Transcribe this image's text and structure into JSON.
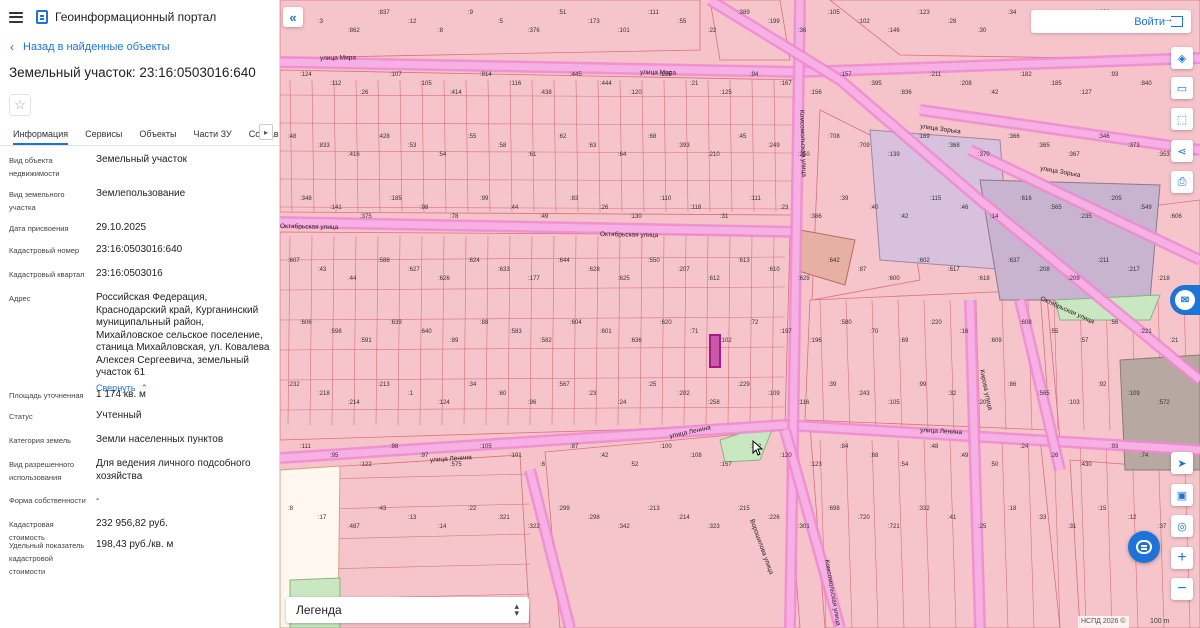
{
  "app": {
    "title": "Геоинформационный портал"
  },
  "panel": {
    "back_label": "Назад в найденные объекты",
    "object_title": "Земельный участок: 23:16:0503016:640",
    "tabs": [
      "Информация",
      "Сервисы",
      "Объекты",
      "Части ЗУ",
      "Состав"
    ],
    "active_tab": "Информация",
    "properties": [
      {
        "label": "Вид объекта недвижимости",
        "value": "Земельный участок"
      },
      {
        "label": "Вид земельного участка",
        "value": "Землепользование"
      },
      {
        "label": "Дата присвоения",
        "value": "29.10.2025"
      },
      {
        "label": "Кадастровый номер",
        "value": "23:16:0503016:640"
      },
      {
        "label": "Кадастровый квартал",
        "value": "23:16:0503016"
      },
      {
        "label": "Адрес",
        "value": "Российская Федерация, Краснодарский край, Курганинский муниципальный район, Михайловское сельское поселение, станица Михайловская, ул. Ковалева Алексея Сергеевича, земельный участок 61"
      },
      {
        "label": "Площадь уточненная",
        "value": "1 174 кв. м"
      },
      {
        "label": "Статус",
        "value": "Учтенный"
      },
      {
        "label": "Категория земель",
        "value": "Земли населенных пунктов"
      },
      {
        "label": "Вид разрешенного использования",
        "value": "Для ведения личного подсобного хозяйства"
      },
      {
        "label": "Форма собственности",
        "value": "-"
      },
      {
        "label": "Кадастровая стоимость",
        "value": "232 956,82 руб."
      },
      {
        "label": "Удельный показатель кадастровой стоимости",
        "value": "198,43 руб./кв. м"
      }
    ],
    "collapse_label": "Свернуть"
  },
  "map": {
    "login_label": "Войти",
    "legend_label": "Легенда",
    "attribution": "НСПД 2026 ©",
    "scale_label": "100 m",
    "streets": [
      "улица Мира",
      "улица Мира",
      "Октябрьская улица",
      "Октябрьская улица",
      "улица Ленина",
      "улица Ленина",
      "улица Ленина",
      "улица Зорька",
      "улица Зорька",
      "Октябрьская улица",
      "Комсомольская улица",
      "Комсомольская улица",
      "Кирова улица",
      "Ворошилова улица"
    ],
    "tools": [
      "layers-icon",
      "ruler-icon",
      "select-area-icon",
      "share-icon",
      "print-icon",
      "navigate-icon",
      "panel-icon",
      "location-icon",
      "zoom-in-icon",
      "zoom-out-icon"
    ],
    "parcel_labels": [
      ":830",
      ":3",
      ":862",
      ":837",
      ":12",
      ":8",
      ":9",
      ":5",
      ":376",
      ":51",
      ":173",
      ":101",
      ":111",
      ":55",
      ":22",
      ":389",
      ":199",
      ":36",
      ":105",
      ":102",
      ":146",
      ":123",
      ":28",
      ":30",
      ":34",
      ":160",
      ":66",
      ":128",
      ":106",
      ":110",
      ":124",
      ":112",
      ":26",
      ":107",
      ":105",
      ":414",
      ":814",
      ":116",
      ":438",
      ":445",
      ":444",
      ":120",
      ":255",
      ":21",
      ":125",
      ":94",
      ":167",
      ":156",
      ":157",
      ":395",
      ":836",
      ":211",
      ":208",
      ":42",
      ":182",
      ":185",
      ":127",
      ":93",
      ":840",
      ":47",
      ":48",
      ":833",
      ":416",
      ":428",
      ":53",
      ":54",
      ":55",
      ":58",
      ":61",
      ":62",
      ":63",
      ":64",
      ":68",
      ":393",
      ":210",
      ":45",
      ":249",
      ":250",
      ":708",
      ":709",
      ":139",
      ":169",
      ":368",
      ":370",
      ":366",
      ":365",
      ":367",
      ":346",
      ":373",
      ":353",
      ":348",
      ":141",
      ":375",
      ":185",
      ":98",
      ":78",
      ":99",
      ":44",
      ":49",
      ":83",
      ":26",
      ":130",
      ":110",
      ":118",
      ":31",
      ":111",
      ":23",
      ":386",
      ":39",
      ":40",
      ":42",
      ":115",
      ":46",
      ":14",
      ":616",
      ":565",
      ":235",
      ":205",
      ":549",
      ":606",
      ":607",
      ":43",
      ":44",
      ":588",
      ":627",
      ":626",
      ":624",
      ":633",
      ":177",
      ":644",
      ":628",
      ":625",
      ":550",
      ":207",
      ":612",
      ":613",
      ":610",
      ":629",
      ":642",
      ":87",
      ":600",
      ":602",
      ":617",
      ":618",
      ":637",
      ":208",
      ":209",
      ":211",
      ":217",
      ":218",
      ":606",
      ":598",
      ":591",
      ":639",
      ":640",
      ":89",
      ":88",
      ":583",
      ":582",
      ":604",
      ":601",
      ":636",
      ":620",
      ":71",
      ":102",
      ":72",
      ":197",
      ":196",
      ":580",
      ":70",
      ":69",
      ":220",
      ":16",
      ":609",
      ":608",
      ":55",
      ":57",
      ":56",
      ":221",
      ":21",
      ":232",
      ":218",
      ":214",
      ":213",
      ":1",
      ":124",
      ":34",
      ":60",
      ":96",
      ":567",
      ":23",
      ":24",
      ":25",
      ":202",
      ":258",
      ":229",
      ":109",
      ":116",
      ":39",
      ":243",
      ":105",
      ":99",
      ":32",
      ":20",
      ":86",
      ":565",
      ":103",
      ":92",
      ":109",
      ":572",
      ":111",
      ":95",
      ":122",
      ":98",
      ":97",
      ":575",
      ":105",
      ":101",
      ":6",
      ":87",
      ":42",
      ":52",
      ":100",
      ":108",
      ":157",
      ":112",
      ":120",
      ":123",
      ":84",
      ":68",
      ":54",
      ":48",
      ":49",
      ":50",
      ":24",
      ":26",
      ":430",
      ":93",
      ":74",
      ":5",
      ":8",
      ":17",
      ":487",
      ":43",
      ":13",
      ":14",
      ":22",
      ":321",
      ":322",
      ":299",
      ":298",
      ":342",
      ":213",
      ":214",
      ":323",
      ":215",
      ":226",
      ":301",
      ":698",
      ":720",
      ":721",
      ":332",
      ":41",
      ":25",
      ":18",
      ":33",
      ":31",
      ":15",
      ":12",
      ":37"
    ]
  },
  "colors": {
    "accent": "#1e73d7",
    "parcel_fill": "#f6c5cb",
    "parcel_stroke": "#d8717d",
    "road": "#ee88d4",
    "building": "#d7c1dc",
    "green": "#c9e7c0",
    "selected": "#b1148f"
  }
}
